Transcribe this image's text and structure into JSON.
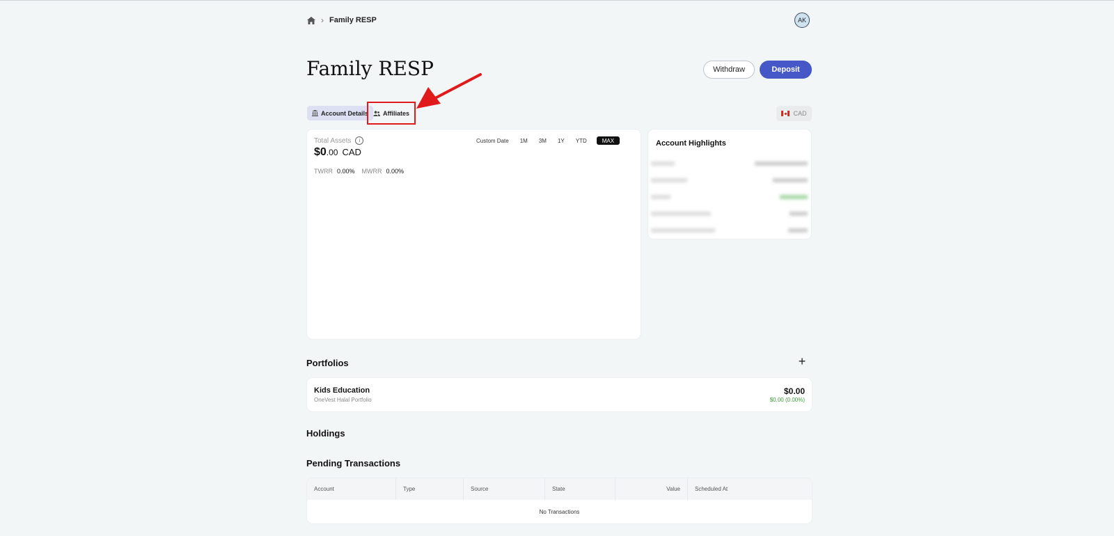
{
  "breadcrumb": {
    "current": "Family RESP"
  },
  "user": {
    "initials": "AK"
  },
  "page": {
    "title": "Family RESP"
  },
  "actions": {
    "withdraw": "Withdraw",
    "deposit": "Deposit"
  },
  "tabs": [
    {
      "label": "Account Details",
      "selected": true
    },
    {
      "label": "Affiliates",
      "selected": false
    }
  ],
  "currency": {
    "code": "CAD"
  },
  "summary": {
    "total_assets_label": "Total Assets",
    "value_whole": "$0",
    "value_cents": ".00",
    "value_currency": "CAD",
    "twrr_label": "TWRR",
    "twrr_value": "0.00%",
    "mwrr_label": "MWRR",
    "mwrr_value": "0.00%"
  },
  "ranges": [
    "Custom Date",
    "1M",
    "3M",
    "1Y",
    "YTD",
    "MAX"
  ],
  "selected_range": "MAX",
  "highlights": {
    "title": "Account Highlights"
  },
  "portfolios": {
    "title": "Portfolios",
    "items": [
      {
        "name": "Kids Education",
        "subtitle": "OneVest Halal Portfolio",
        "value": "$0.00",
        "change": "$0.00 (0.00%)"
      }
    ]
  },
  "holdings": {
    "title": "Holdings"
  },
  "pending": {
    "title": "Pending Transactions",
    "columns": [
      "Account",
      "Type",
      "Source",
      "State",
      "Value",
      "Scheduled At"
    ],
    "empty_text": "No Transactions"
  },
  "colors": {
    "accent": "#4658c8",
    "annotation": "#e01a1a",
    "positive": "#3a9a3a"
  }
}
